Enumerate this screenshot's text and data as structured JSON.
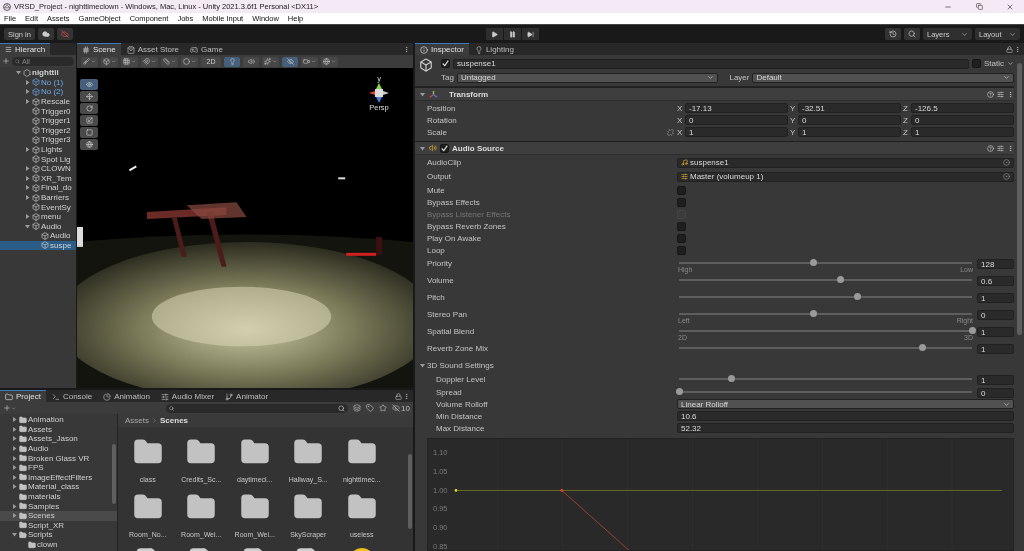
{
  "window": {
    "title": "VRSD_Project - nighttimeclown - Windows, Mac, Linux - Unity 2021.3.6f1 Personal <DX11>"
  },
  "menu": [
    "File",
    "Edit",
    "Assets",
    "GameObject",
    "Component",
    "Jobs",
    "Mobile Input",
    "Window",
    "Help"
  ],
  "toolbar": {
    "sign_in": "Sign in",
    "layers": "Layers",
    "layout": "Layout"
  },
  "hierarchy": {
    "title": "Hierarch",
    "search": {
      "placeholder": "All"
    },
    "items": [
      {
        "label": "nighttii",
        "kind": "scene",
        "expanded": true,
        "selected": false,
        "children": [
          {
            "label": "No (1)",
            "kind": "prefab",
            "expanded": false,
            "selected": false
          },
          {
            "label": "No (2)",
            "kind": "prefab",
            "expanded": false,
            "selected": false
          },
          {
            "label": "Rescale",
            "kind": "object",
            "expanded": false,
            "selected": false
          },
          {
            "label": "Trigger0",
            "kind": "object",
            "selected": false
          },
          {
            "label": "Trigger1",
            "kind": "object",
            "selected": false
          },
          {
            "label": "Trigger2",
            "kind": "object",
            "selected": false
          },
          {
            "label": "Trigger3",
            "kind": "object",
            "selected": false
          },
          {
            "label": "Lights",
            "kind": "object",
            "expanded": false,
            "selected": false
          },
          {
            "label": "Spot Lig",
            "kind": "object",
            "selected": false
          },
          {
            "label": "CLOWN",
            "kind": "object",
            "expanded": false,
            "selected": false
          },
          {
            "label": "XR_Tem",
            "kind": "object",
            "expanded": false,
            "selected": false
          },
          {
            "label": "Final_do",
            "kind": "object",
            "expanded": false,
            "selected": false
          },
          {
            "label": "Barriers",
            "kind": "object",
            "expanded": false,
            "selected": false
          },
          {
            "label": "EventSy",
            "kind": "object",
            "selected": false
          },
          {
            "label": "menu",
            "kind": "object",
            "expanded": false,
            "selected": false
          },
          {
            "label": "Audio",
            "kind": "object",
            "expanded": true,
            "selected": false,
            "children": [
              {
                "label": "Audio",
                "kind": "object",
                "selected": false
              },
              {
                "label": "suspe",
                "kind": "object",
                "selected": true
              }
            ]
          }
        ]
      }
    ]
  },
  "scene": {
    "tabs": [
      {
        "label": "Scene",
        "kind": "scene",
        "selected": true
      },
      {
        "label": "Asset Store",
        "kind": "store",
        "selected": false
      },
      {
        "label": "Game",
        "kind": "game",
        "selected": false
      }
    ],
    "toolbar": [
      {
        "kind": "draw_mode",
        "selected": false
      },
      {
        "kind": "render",
        "selected": false
      },
      {
        "kind": "grid",
        "selected": false
      },
      {
        "kind": "snap",
        "selected": false
      },
      {
        "kind": "increment",
        "selected": false
      },
      {
        "kind": "shading",
        "selected": false
      },
      {
        "kind": "text",
        "label": "2D",
        "selected": false
      },
      {
        "kind": "lighting",
        "selected": true
      },
      {
        "kind": "audio",
        "selected": false
      },
      {
        "kind": "effects",
        "selected": false
      },
      {
        "kind": "visibility",
        "selected": true
      },
      {
        "kind": "camera",
        "selected": false
      },
      {
        "kind": "gizmos",
        "selected": false
      }
    ],
    "tools": [
      {
        "kind": "view",
        "selected": true
      },
      {
        "kind": "move",
        "selected": false
      },
      {
        "kind": "rotate",
        "selected": false
      },
      {
        "kind": "scale",
        "selected": false
      },
      {
        "kind": "rect",
        "selected": false
      },
      {
        "kind": "transform",
        "selected": false
      }
    ],
    "gizmo": {
      "axis": "y",
      "label": "Persp"
    }
  },
  "inspector": {
    "tabs": [
      {
        "label": "Inspector",
        "kind": "info",
        "selected": true
      },
      {
        "label": "Lighting",
        "kind": "light",
        "selected": false
      }
    ],
    "object": {
      "active": true,
      "name": "suspense1",
      "static": false,
      "static_label": "Static",
      "tag_label": "Tag",
      "tag": "Untagged",
      "layer_label": "Layer",
      "layer": "Default"
    },
    "components": [
      {
        "kind": "transform",
        "title": "Transform",
        "expanded": true,
        "rows": [
          {
            "label": "Position",
            "linked": false,
            "fields": [
              {
                "axis": "X",
                "value": "-17.13"
              },
              {
                "axis": "Y",
                "value": "-32.51"
              },
              {
                "axis": "Z",
                "value": "-126.5"
              }
            ]
          },
          {
            "label": "Rotation",
            "linked": false,
            "fields": [
              {
                "axis": "X",
                "value": "0"
              },
              {
                "axis": "Y",
                "value": "0"
              },
              {
                "axis": "Z",
                "value": "0"
              }
            ]
          },
          {
            "label": "Scale",
            "linked": true,
            "fields": [
              {
                "axis": "X",
                "value": "1"
              },
              {
                "axis": "Y",
                "value": "1"
              },
              {
                "axis": "Z",
                "value": "1"
              }
            ]
          }
        ]
      },
      {
        "kind": "audio",
        "title": "Audio Source",
        "enabled": true,
        "expanded": true,
        "properties": [
          {
            "kind": "clip",
            "label": "AudioClip",
            "value": "suspense1"
          },
          {
            "kind": "mixer",
            "label": "Output",
            "value": "Master (volumeup 1)"
          },
          {
            "kind": "checkbox",
            "label": "Mute",
            "checked": false,
            "disabled": false
          },
          {
            "kind": "checkbox",
            "label": "Bypass Effects",
            "checked": false,
            "disabled": false
          },
          {
            "kind": "checkbox",
            "label": "Bypass Listener Effects",
            "checked": false,
            "disabled": true
          },
          {
            "kind": "checkbox",
            "label": "Bypass Reverb Zones",
            "checked": false,
            "disabled": false
          },
          {
            "kind": "checkbox",
            "label": "Play On Awake",
            "checked": false,
            "disabled": false
          },
          {
            "kind": "checkbox",
            "label": "Loop",
            "checked": false,
            "disabled": false
          },
          {
            "kind": "slider",
            "label": "Priority",
            "level": 0.46,
            "value": "128",
            "min_label": "High",
            "max_label": "Low"
          },
          {
            "kind": "slider",
            "label": "Volume",
            "level": 0.55,
            "value": "0.6"
          },
          {
            "kind": "slider",
            "label": "Pitch",
            "level": 0.61,
            "value": "1"
          },
          {
            "kind": "slider",
            "label": "Stereo Pan",
            "level": 0.46,
            "value": "0",
            "min_label": "Left",
            "max_label": "Right"
          },
          {
            "kind": "slider",
            "label": "Spatial Blend",
            "level": 1,
            "value": "1",
            "min_label": "2D",
            "max_label": "3D"
          },
          {
            "kind": "slider",
            "label": "Reverb Zone Mix",
            "level": 0.83,
            "value": "1"
          },
          {
            "kind": "foldout",
            "label": "3D Sound Settings",
            "expanded": true,
            "children": [
              {
                "kind": "slider",
                "label": "Doppler Level",
                "level": 0.18,
                "value": "1"
              },
              {
                "kind": "slider",
                "label": "Spread",
                "level": 0,
                "value": "0"
              },
              {
                "kind": "dropdown",
                "label": "Volume Rolloff",
                "value": "Linear Rolloff"
              },
              {
                "kind": "number",
                "label": "Min Distance",
                "value": "10.6"
              },
              {
                "kind": "number",
                "label": "Max Distance",
                "value": "52.32"
              }
            ]
          }
        ],
        "rolloff_graph": {
          "y_labels": [
            "1.10",
            "1.05",
            "1.00",
            "0.95",
            "0.90",
            "0.85"
          ]
        }
      }
    ]
  },
  "project": {
    "tabs": [
      {
        "label": "Project",
        "kind": "folder",
        "selected": true
      },
      {
        "label": "Console",
        "kind": "console",
        "selected": false
      },
      {
        "label": "Animation",
        "kind": "animation",
        "selected": false
      },
      {
        "label": "Audio Mixer",
        "kind": "mixer",
        "selected": false
      },
      {
        "label": "Animator",
        "kind": "animator",
        "selected": false
      }
    ],
    "hidden_count": "10",
    "tree": [
      {
        "label": "Animation",
        "expanded": false,
        "selected": false
      },
      {
        "label": "Assets",
        "expanded": false,
        "selected": false
      },
      {
        "label": "Assets_Jason",
        "expanded": false,
        "selected": false
      },
      {
        "label": "Audio",
        "expanded": false,
        "selected": false
      },
      {
        "label": "Broken Glass VR",
        "expanded": false,
        "selected": false
      },
      {
        "label": "FPS",
        "expanded": false,
        "selected": false
      },
      {
        "label": "ImageEffectFilters",
        "expanded": false,
        "selected": false
      },
      {
        "label": "Material_class",
        "expanded": false,
        "selected": false
      },
      {
        "label": "materials",
        "selected": false
      },
      {
        "label": "Samples",
        "expanded": false,
        "selected": false
      },
      {
        "label": "Scenes",
        "expanded": false,
        "selected": true
      },
      {
        "label": "Script_XR",
        "selected": false
      },
      {
        "label": "Scripts",
        "expanded": true,
        "selected": false,
        "children": [
          {
            "label": "clown",
            "selected": false
          }
        ]
      }
    ],
    "breadcrumb": [
      "Assets",
      "Scenes"
    ],
    "assets": [
      {
        "kind": "folder",
        "label": "class"
      },
      {
        "kind": "folder",
        "label": "Credits_Sc..."
      },
      {
        "kind": "folder",
        "label": "daytimecl..."
      },
      {
        "kind": "folder",
        "label": "Hallway_S..."
      },
      {
        "kind": "folder",
        "label": "nighttimec..."
      },
      {
        "kind": "folder",
        "label": "Room_No..."
      },
      {
        "kind": "folder",
        "label": "Room_Wei..."
      },
      {
        "kind": "folder",
        "label": "Room_Wei..."
      },
      {
        "kind": "folder",
        "label": "SkyScraper"
      },
      {
        "kind": "folder",
        "label": "useless"
      },
      {
        "kind": "document"
      },
      {
        "kind": "document"
      },
      {
        "kind": "document"
      },
      {
        "kind": "document"
      },
      {
        "kind": "sphere"
      }
    ]
  }
}
